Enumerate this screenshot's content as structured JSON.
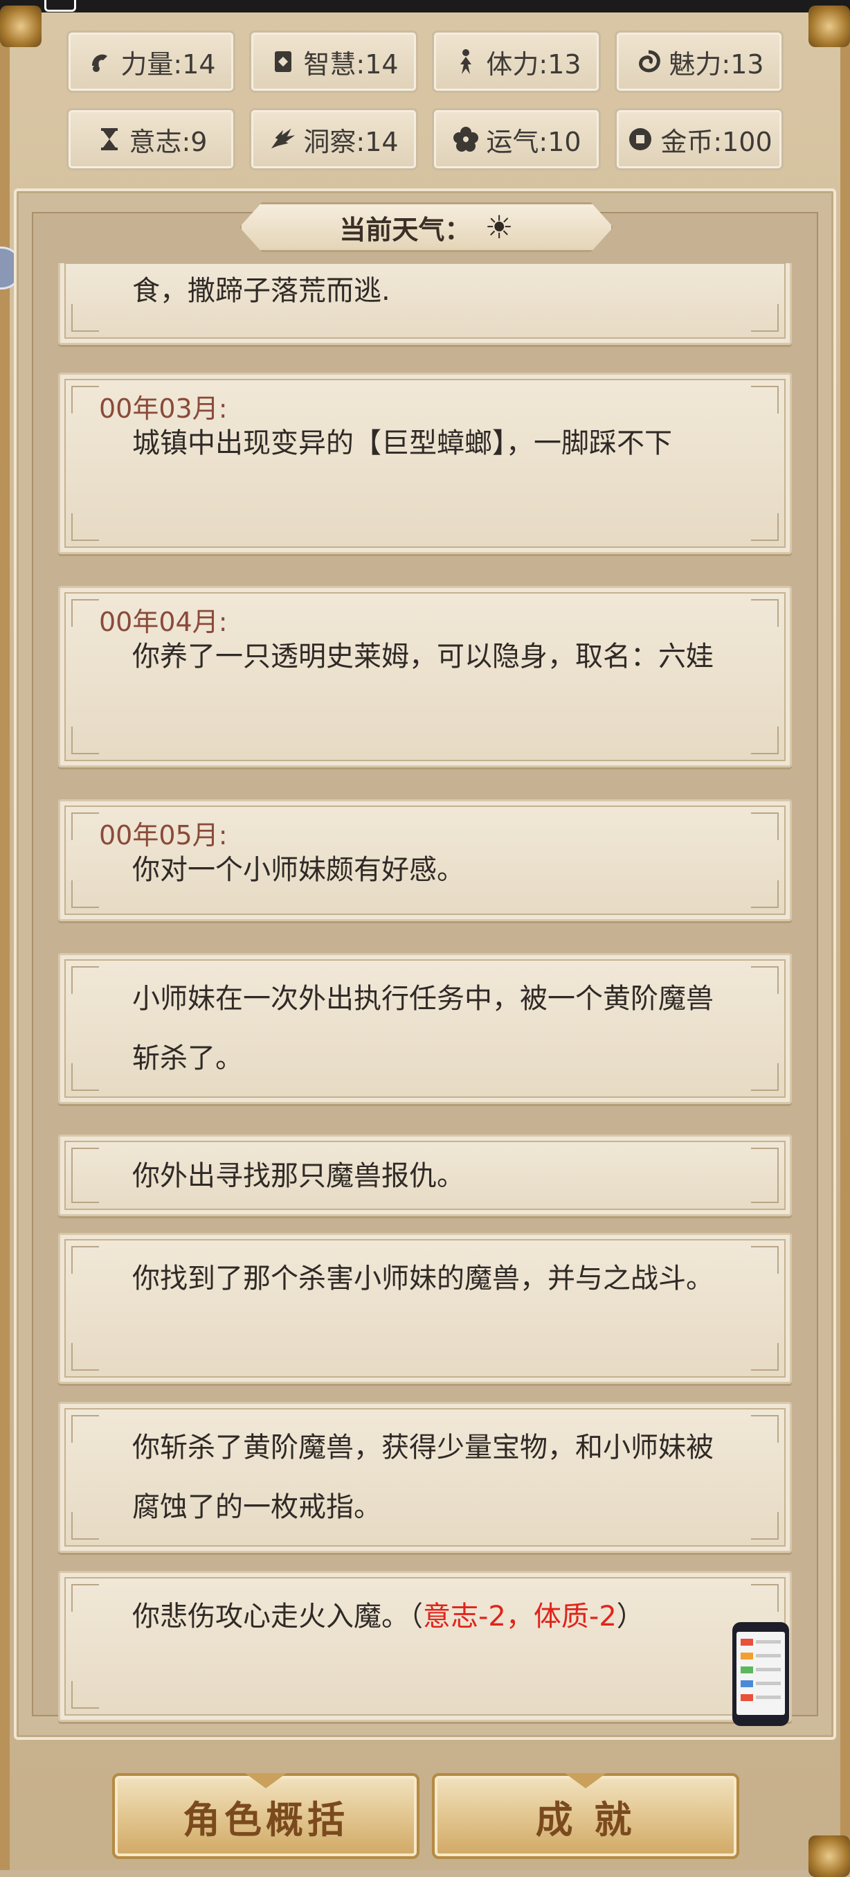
{
  "stats": [
    {
      "label": "力量:14",
      "icon": "strength-icon"
    },
    {
      "label": "智慧:14",
      "icon": "wisdom-icon"
    },
    {
      "label": "体力:13",
      "icon": "stamina-icon"
    },
    {
      "label": "魅力:13",
      "icon": "charm-icon"
    },
    {
      "label": "意志:9",
      "icon": "hourglass-icon"
    },
    {
      "label": "洞察:14",
      "icon": "insight-icon"
    },
    {
      "label": "运气:10",
      "icon": "luck-icon"
    },
    {
      "label": "金币:100",
      "icon": "coin-icon"
    }
  ],
  "weather": {
    "label": "当前天气：",
    "icon": "sun-icon",
    "glyph": "☀"
  },
  "events": [
    {
      "date": "",
      "text": "食，撒蹄子落荒而逃."
    },
    {
      "date": "00年03月:",
      "text": "城镇中出现变异的【巨型蟑螂】，一脚踩不下"
    },
    {
      "date": "00年04月:",
      "text": "你养了一只透明史莱姆，可以隐身，取名：六娃"
    },
    {
      "date": "00年05月:",
      "text": "你对一个小师妹颇有好感。"
    },
    {
      "date": "",
      "text": "小师妹在一次外出执行任务中，被一个黄阶魔兽斩杀了。"
    },
    {
      "date": "",
      "text": "你外出寻找那只魔兽报仇。"
    },
    {
      "date": "",
      "text": "你找到了那个杀害小师妹的魔兽，并与之战斗。"
    },
    {
      "date": "",
      "text": "你斩杀了黄阶魔兽，获得少量宝物，和小师妹被腐蚀了的一枚戒指。"
    },
    {
      "date": "",
      "text_prefix": "你悲伤攻心走火入魔。（",
      "text_effect": "意志-2，体质-2",
      "text_suffix": "）"
    }
  ],
  "buttons": {
    "summary": "角色概括",
    "achievements": "成 就"
  },
  "colors": {
    "effect_red": "#e0241b",
    "date_brown": "#8a4a3a",
    "button_text": "#7a4a1e"
  }
}
